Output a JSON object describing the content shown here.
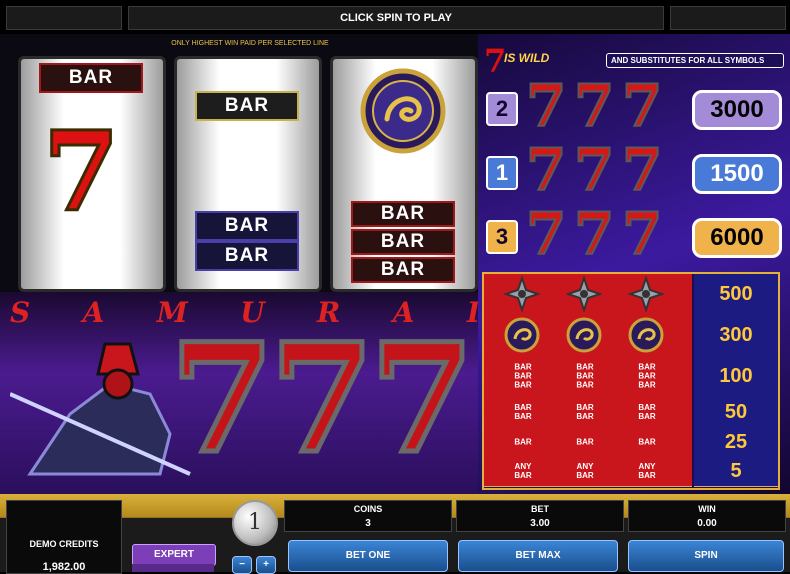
{
  "top": {
    "message": "CLICK SPIN TO PLAY"
  },
  "reels": {
    "hint": "ONLY HIGHEST WIN PAID PER SELECTED LINE",
    "bar_label": "BAR"
  },
  "paytable": {
    "wild_seven": "7",
    "wild_text": "IS WILD",
    "wild_sub": "AND SUBSTITUTES FOR ALL SYMBOLS",
    "rows": [
      {
        "mult": "2",
        "value": "3000",
        "color": "#a38bd8"
      },
      {
        "mult": "1",
        "value": "1500",
        "color": "#4a7ad8"
      },
      {
        "mult": "3",
        "value": "6000",
        "color": "#f0b24a"
      }
    ],
    "table": [
      {
        "symbol": "shuriken",
        "value": "500"
      },
      {
        "symbol": "dragon",
        "value": "300"
      },
      {
        "symbol": "triple-bar",
        "value": "100"
      },
      {
        "symbol": "double-bar",
        "value": "50"
      },
      {
        "symbol": "single-bar",
        "value": "25"
      },
      {
        "symbol": "any-bar",
        "value": "5"
      }
    ],
    "any_label": "ANY"
  },
  "logo": {
    "letters": [
      "S",
      "A",
      "M",
      "U",
      "R",
      "A",
      "I"
    ]
  },
  "controls": {
    "demo_label": "DEMO CREDITS",
    "demo_value": "1,982.00",
    "expert_label": "EXPERT",
    "coin_value": "1",
    "coins_label": "COINS",
    "coins_value": "3",
    "bet_label": "BET",
    "bet_value": "3.00",
    "win_label": "WIN",
    "win_value": "0.00",
    "bet_one": "BET ONE",
    "bet_max": "BET MAX",
    "spin": "SPIN",
    "minus": "−",
    "plus": "+"
  }
}
